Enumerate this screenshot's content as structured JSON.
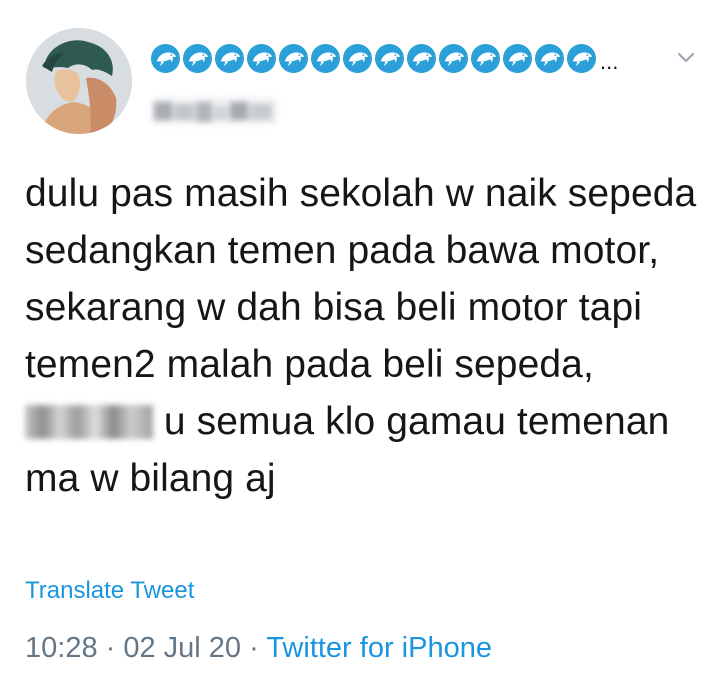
{
  "tweet": {
    "display_name_emoji": "dolphin-icon",
    "display_name_emoji_count": 14,
    "display_name_suffix": "...",
    "text_before_censor": "dulu pas masih sekolah w naik sepeda sedangkan temen pada bawa motor, sekarang w dah bisa beli motor tapi temen2 malah pada beli sepeda, ",
    "text_after_censor": " u semua klo gamau temenan ma w bilang aj",
    "translate_label": "Translate Tweet",
    "time": "10:28",
    "separator": " · ",
    "date": "02 Jul 20",
    "source": "Twitter for iPhone"
  },
  "colors": {
    "text": "#14171a",
    "secondary": "#657786",
    "link": "#1b95e0",
    "dolphin": "#2a9fd8"
  }
}
